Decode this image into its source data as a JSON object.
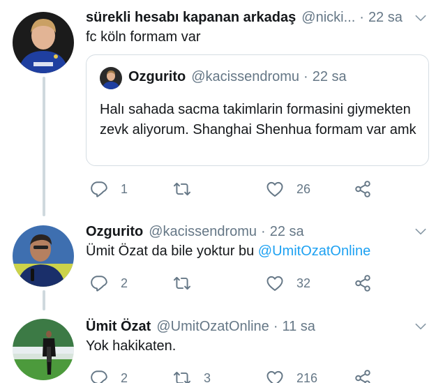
{
  "tweets": [
    {
      "name": "sürekli hesabı kapanan arkadaş",
      "handle": "@nicki...",
      "time": "22 sa",
      "text": "fc köln formam var",
      "quote": {
        "name": "Ozgurito",
        "handle": "@kacissendromu",
        "time": "22 sa",
        "text": "Halı sahada sacma takimlarin formasini giymekten zevk aliyorum. Shanghai Shenhua formam var amk"
      },
      "replies": "1",
      "retweets": "",
      "likes": "26"
    },
    {
      "name": "Ozgurito",
      "handle": "@kacissendromu",
      "time": "22 sa",
      "text": "Ümit Özat da bile yoktur bu ",
      "mention": "@UmitOzatOnline",
      "replies": "2",
      "retweets": "",
      "likes": "32"
    },
    {
      "name": "Ümit Özat",
      "handle": "@UmitOzatOnline",
      "time": "11 sa",
      "text": "Yok hakikaten.",
      "replies": "2",
      "retweets": "3",
      "likes": "216"
    }
  ],
  "separator": "·",
  "icons": {
    "reply": "reply-icon",
    "retweet": "retweet-icon",
    "like": "heart-icon",
    "share": "share-icon",
    "more": "chevron-down-icon"
  },
  "colors": {
    "text": "#14171a",
    "secondary": "#657786",
    "link": "#1da1f2",
    "thread": "#cfd9de"
  }
}
